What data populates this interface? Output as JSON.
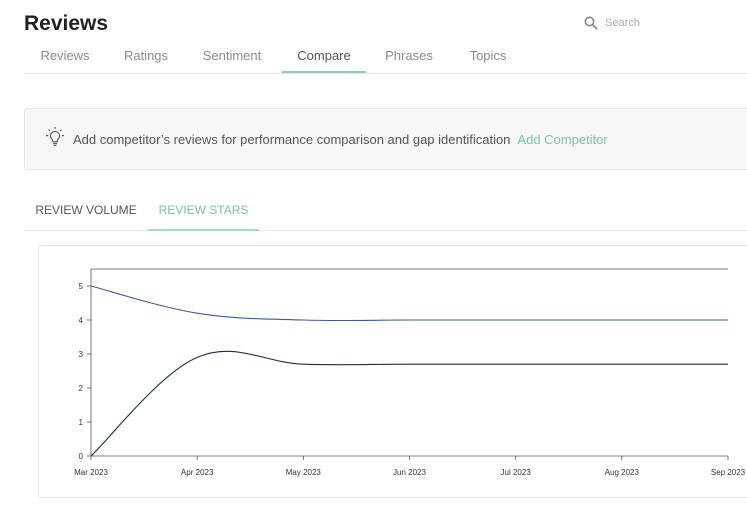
{
  "header": {
    "title": "Reviews"
  },
  "search": {
    "placeholder": "Search"
  },
  "tabs": [
    {
      "label": "Reviews",
      "active": false
    },
    {
      "label": "Ratings",
      "active": false
    },
    {
      "label": "Sentiment",
      "active": false
    },
    {
      "label": "Compare",
      "active": true
    },
    {
      "label": "Phrases",
      "active": false
    },
    {
      "label": "Topics",
      "active": false
    }
  ],
  "banner": {
    "text": "Add competitor’s reviews for performance comparison and gap identification",
    "link": "Add Competitor",
    "icon": "lightbulb-icon"
  },
  "subtabs": [
    {
      "label": "REVIEW VOLUME",
      "active": false
    },
    {
      "label": "REVIEW STARS",
      "active": true
    }
  ],
  "colors": {
    "accent": "#7cc2a8",
    "series_light": "#3d5a9e",
    "series_dark": "#1c2b4a"
  },
  "chart_data": {
    "type": "line",
    "x": [
      "Mar 2023",
      "Apr 2023",
      "May 2023",
      "Jun 2023",
      "Jul 2023",
      "Aug 2023",
      "Sep 2023"
    ],
    "yticks": [
      0,
      1,
      2,
      3,
      4,
      5
    ],
    "ylim": [
      0,
      5.5
    ],
    "grid": false,
    "series": [
      {
        "color": "#3d5a9e",
        "values": [
          5.0,
          4.2,
          4.0,
          4.0,
          4.0,
          4.0,
          4.0
        ]
      },
      {
        "color": "#1c2b4a",
        "values": [
          0.0,
          2.9,
          2.7,
          2.7,
          2.7,
          2.7,
          2.7
        ]
      }
    ]
  }
}
